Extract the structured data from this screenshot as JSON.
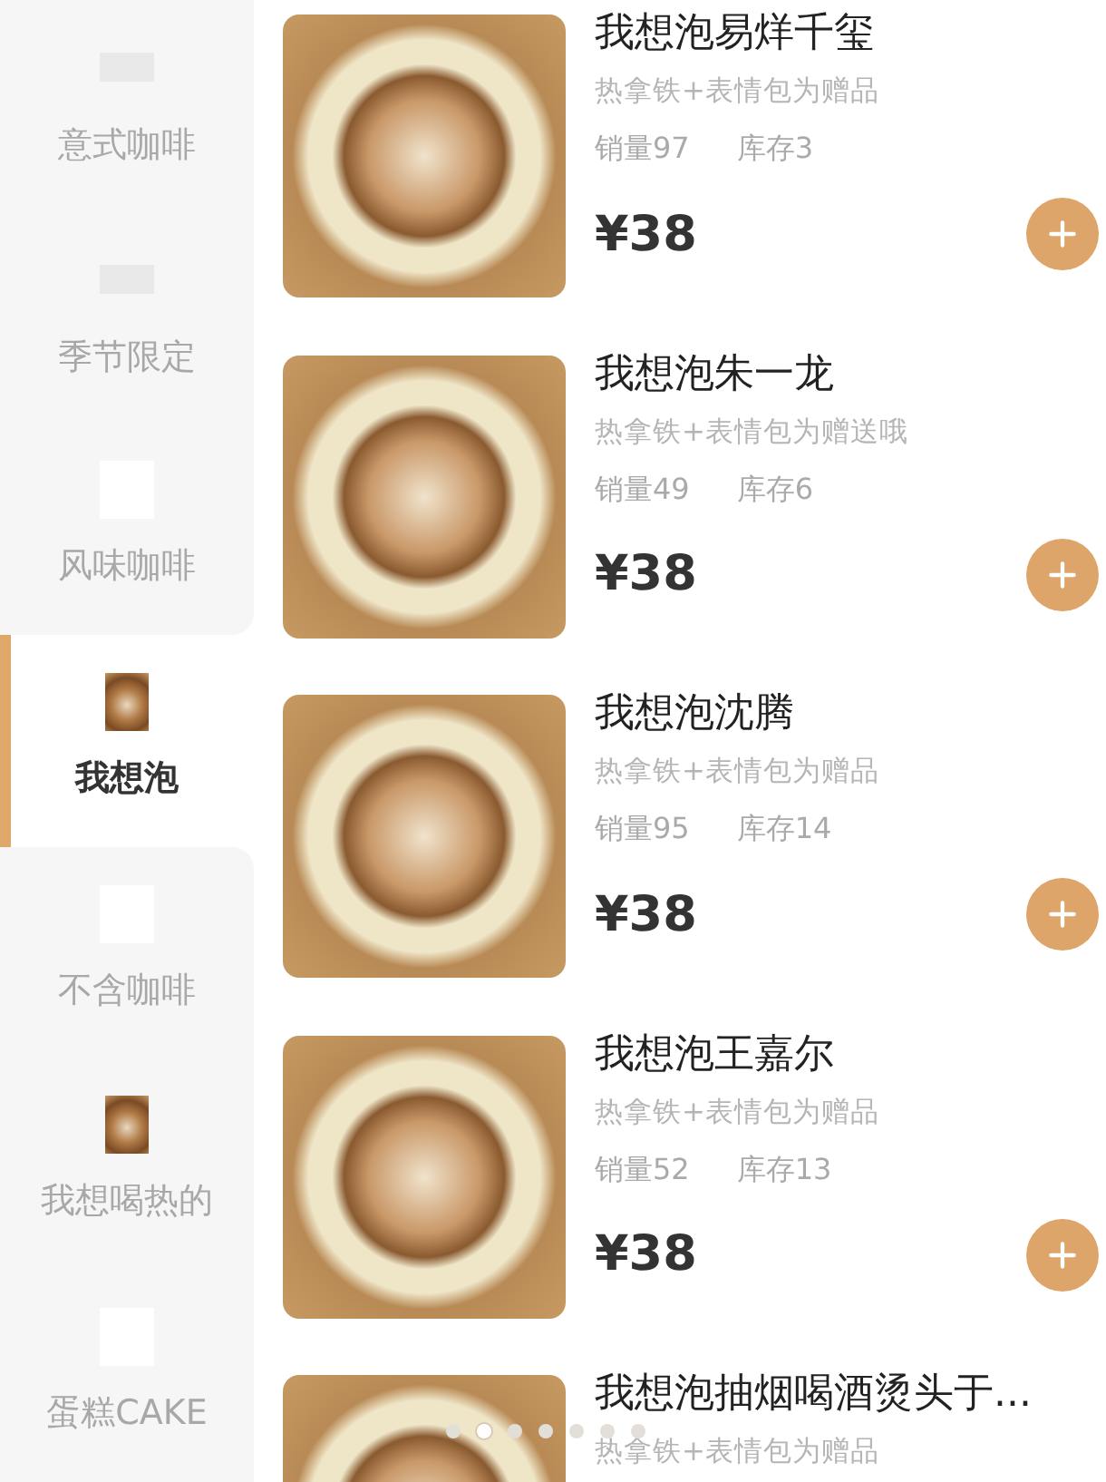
{
  "sidebar": {
    "items": [
      {
        "label": "意式咖啡",
        "selected": false,
        "kind": "gray"
      },
      {
        "label": "季节限定",
        "selected": false,
        "kind": "gray"
      },
      {
        "label": "风味咖啡",
        "selected": false,
        "kind": "white"
      },
      {
        "label": "我想泡",
        "selected": true,
        "kind": "photo"
      },
      {
        "label": "不含咖啡",
        "selected": false,
        "kind": "white"
      },
      {
        "label": "我想喝热的",
        "selected": false,
        "kind": "photo"
      },
      {
        "label": "蛋糕CAKE",
        "selected": false,
        "kind": "white"
      }
    ]
  },
  "products": [
    {
      "name": "我想泡易烊千玺",
      "description": "热拿铁+表情包为赠品",
      "sales": "销量97",
      "stock": "库存3",
      "price": "¥38"
    },
    {
      "name": "我想泡朱一龙",
      "description": "热拿铁+表情包为赠送哦",
      "sales": "销量49",
      "stock": "库存6",
      "price": "¥38"
    },
    {
      "name": "我想泡沈腾",
      "description": "热拿铁+表情包为赠品",
      "sales": "销量95",
      "stock": "库存14",
      "price": "¥38"
    },
    {
      "name": "我想泡王嘉尔",
      "description": "热拿铁+表情包为赠品",
      "sales": "销量52",
      "stock": "库存13",
      "price": "¥38"
    },
    {
      "name": "我想泡抽烟喝酒烫头于...",
      "description": "热拿铁+表情包为赠品"
    }
  ],
  "pager": {
    "dots": [
      {
        "selected": false
      },
      {
        "selected": true
      },
      {
        "selected": false
      },
      {
        "selected": false
      },
      {
        "selected": false
      },
      {
        "selected": false
      },
      {
        "selected": false
      }
    ]
  }
}
